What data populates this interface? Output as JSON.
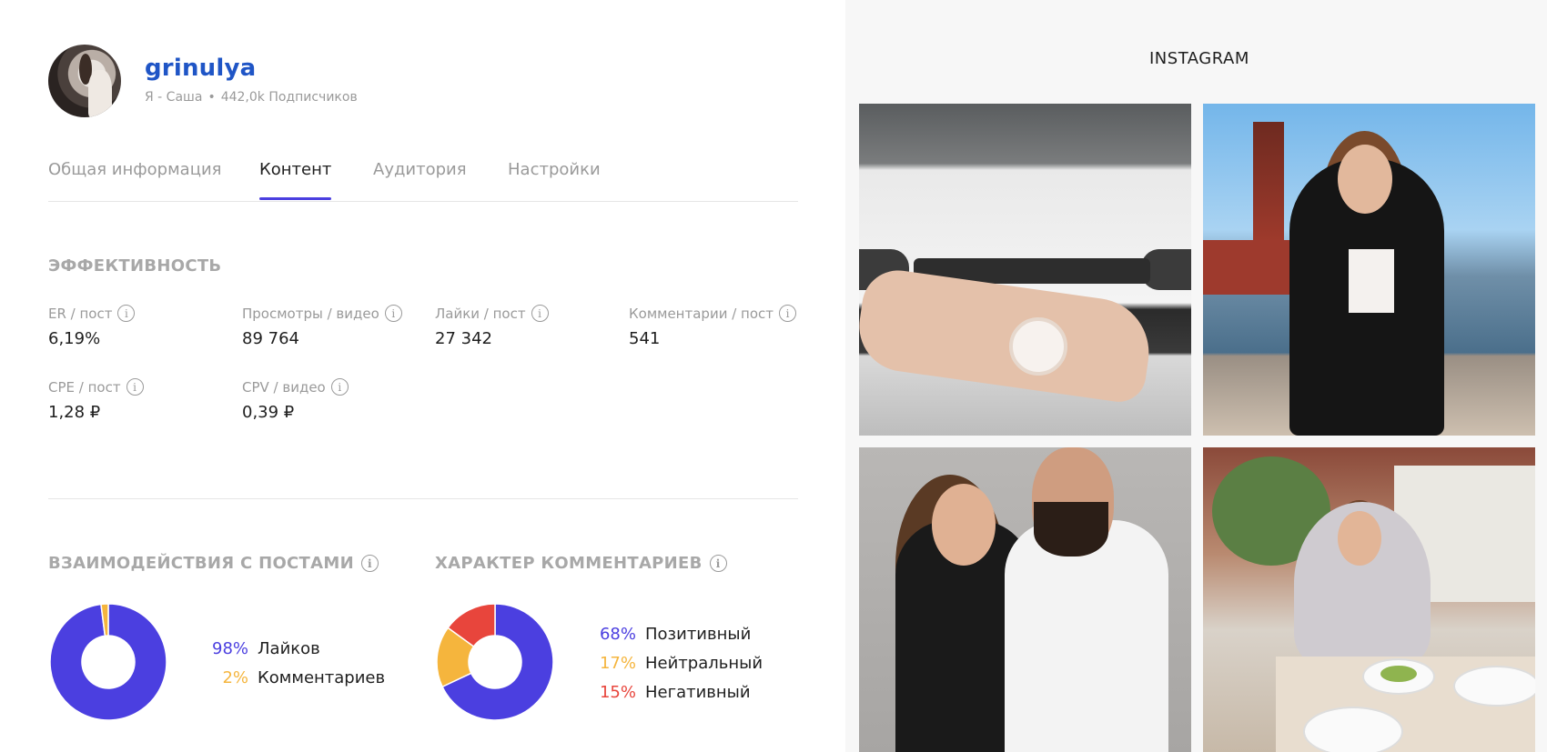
{
  "profile": {
    "username": "grinulya",
    "name": "Я - Саша",
    "followers": "442,0k Подписчиков"
  },
  "tabs": [
    {
      "label": "Общая информация",
      "active": false
    },
    {
      "label": "Контент",
      "active": true
    },
    {
      "label": "Аудитория",
      "active": false
    },
    {
      "label": "Настройки",
      "active": false
    }
  ],
  "performance": {
    "title": "ЭФФЕКТИВНОСТЬ",
    "metrics": [
      {
        "label": "ER / пост",
        "value": "6,19%"
      },
      {
        "label": "Просмотры / видео",
        "value": "89 764"
      },
      {
        "label": "Лайки / пост",
        "value": "27 342"
      },
      {
        "label": "Комментарии / пост",
        "value": "541"
      },
      {
        "label": "CPE / пост",
        "value": "1,28 ₽"
      },
      {
        "label": "CPV / видео",
        "value": "0,39 ₽"
      }
    ]
  },
  "interactions": {
    "title": "ВЗАИМОДЕЙСТВИЯ С ПОСТАМИ",
    "legend": [
      {
        "pct": "98%",
        "label": "Лайков",
        "color": "#4b3fe0"
      },
      {
        "pct": "2%",
        "label": "Комментариев",
        "color": "#f5b53d"
      }
    ]
  },
  "comments": {
    "title": "ХАРАКТЕР КОММЕНТАРИЕВ",
    "legend": [
      {
        "pct": "68%",
        "label": "Позитивный",
        "color": "#4b3fe0"
      },
      {
        "pct": "17%",
        "label": "Нейтральный",
        "color": "#f5b53d"
      },
      {
        "pct": "15%",
        "label": "Негативный",
        "color": "#e8453c"
      }
    ]
  },
  "instagram": {
    "title": "INSTAGRAM"
  },
  "chart_data": [
    {
      "type": "pie",
      "title": "ВЗАИМОДЕЙСТВИЯ С ПОСТАМИ",
      "categories": [
        "Лайков",
        "Комментариев"
      ],
      "values": [
        98,
        2
      ],
      "colors": [
        "#4b3fe0",
        "#f5b53d"
      ]
    },
    {
      "type": "pie",
      "title": "ХАРАКТЕР КОММЕНТАРИЕВ",
      "categories": [
        "Позитивный",
        "Нейтральный",
        "Негативный"
      ],
      "values": [
        68,
        17,
        15
      ],
      "colors": [
        "#4b3fe0",
        "#f5b53d",
        "#e8453c"
      ]
    }
  ]
}
